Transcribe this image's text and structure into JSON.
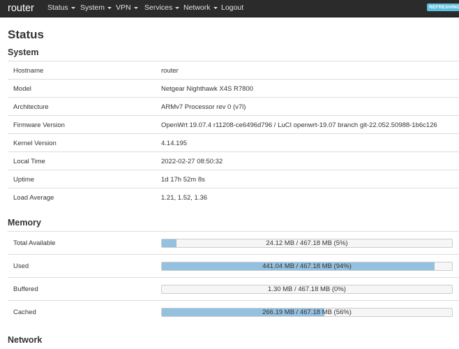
{
  "navbar": {
    "brand": "router",
    "items": [
      {
        "label": "Status",
        "dropdown": true
      },
      {
        "label": "System",
        "dropdown": true
      },
      {
        "label": "VPN",
        "dropdown": true
      },
      {
        "label": "Services",
        "dropdown": true
      },
      {
        "label": "Network",
        "dropdown": true
      },
      {
        "label": "Logout",
        "dropdown": false
      }
    ],
    "refresh_badge": "REFRESHING"
  },
  "page_title": "Status",
  "system": {
    "heading": "System",
    "rows": [
      {
        "label": "Hostname",
        "value": "router"
      },
      {
        "label": "Model",
        "value": "Netgear Nighthawk X4S R7800"
      },
      {
        "label": "Architecture",
        "value": "ARMv7 Processor rev 0 (v7l)"
      },
      {
        "label": "Firmware Version",
        "value": "OpenWrt 19.07.4 r11208-ce6496d796 / LuCI openwrt-19.07 branch git-22.052.50988-1b6c126"
      },
      {
        "label": "Kernel Version",
        "value": "4.14.195"
      },
      {
        "label": "Local Time",
        "value": "2022-02-27 08:50:32"
      },
      {
        "label": "Uptime",
        "value": "1d 17h 52m 8s"
      },
      {
        "label": "Load Average",
        "value": "1.21, 1.52, 1.36"
      }
    ]
  },
  "memory": {
    "heading": "Memory",
    "rows": [
      {
        "label": "Total Available",
        "text": "24.12 MB / 467.18 MB (5%)",
        "percent": 5
      },
      {
        "label": "Used",
        "text": "441.04 MB / 467.18 MB (94%)",
        "percent": 94
      },
      {
        "label": "Buffered",
        "text": "1.30 MB / 467.18 MB (0%)",
        "percent": 0
      },
      {
        "label": "Cached",
        "text": "266.19 MB / 467.18 MB (56%)",
        "percent": 56
      }
    ]
  },
  "network": {
    "heading": "Network"
  },
  "colors": {
    "navbar": "#2b2b2b",
    "badge": "#5bc0de",
    "bar_fill": "#94c1e0"
  }
}
